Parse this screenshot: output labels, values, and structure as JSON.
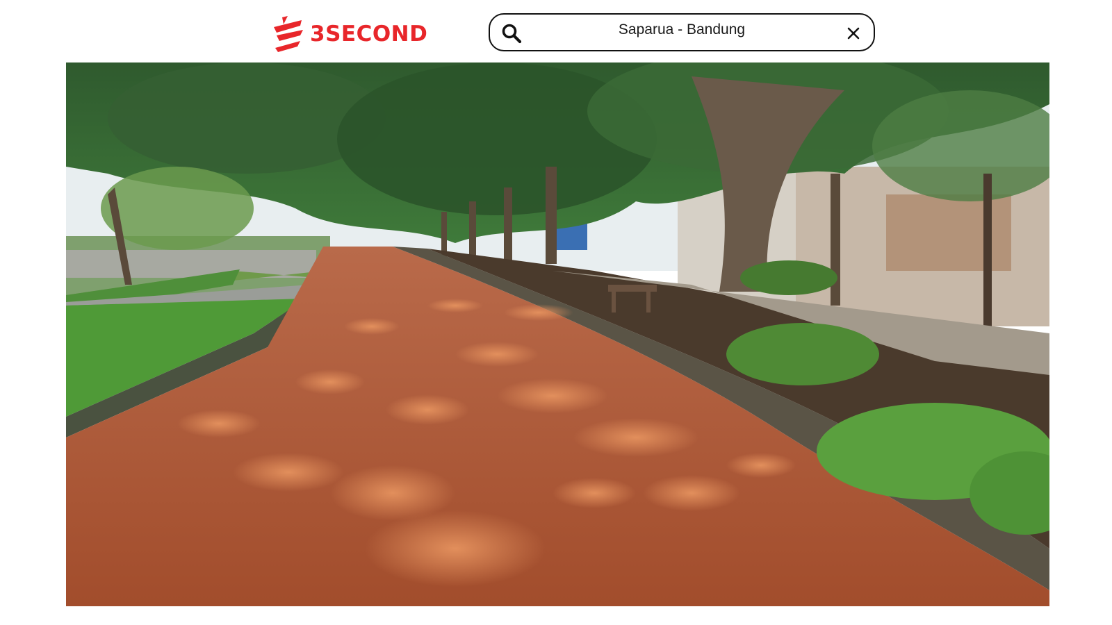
{
  "header": {
    "logo_text": "3SECOND",
    "logo_color": "#e8262a"
  },
  "search": {
    "value": "Saparua - Bandung",
    "icon": "search-icon",
    "clear_icon": "close-icon"
  },
  "photo": {
    "scene": "tree-lined red dirt jogging track in a park"
  }
}
